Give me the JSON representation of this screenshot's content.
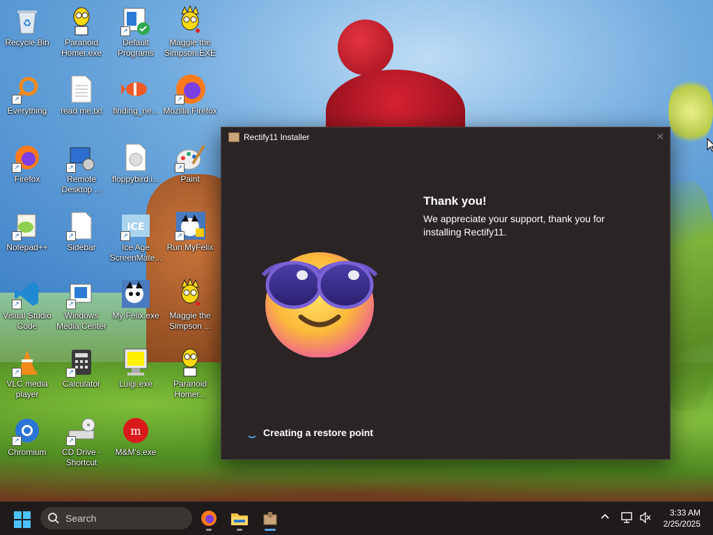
{
  "desktop": {
    "icons": [
      {
        "label": "Recycle Bin",
        "icon": "recycle-bin-icon"
      },
      {
        "label": "Paranoid Homer.exe",
        "icon": "homer-icon"
      },
      {
        "label": "Default Programs",
        "icon": "default-programs-icon"
      },
      {
        "label": "Maggie the Simpson.EXE",
        "icon": "maggie-icon"
      },
      {
        "label": "Everything",
        "icon": "magnifier-icon"
      },
      {
        "label": "read me.txt",
        "icon": "text-file-icon"
      },
      {
        "label": "finding_ne...",
        "icon": "fish-icon"
      },
      {
        "label": "Mozilla Firefox",
        "icon": "firefox-icon"
      },
      {
        "label": "Firefox",
        "icon": "firefox-icon"
      },
      {
        "label": "Remote Desktop ...",
        "icon": "remote-desktop-icon"
      },
      {
        "label": "floppybird.i...",
        "icon": "disc-image-icon"
      },
      {
        "label": "Paint",
        "icon": "paint-icon"
      },
      {
        "label": "Notepad++",
        "icon": "notepadpp-icon"
      },
      {
        "label": "Sidebar",
        "icon": "blank-file-icon"
      },
      {
        "label": "Ice Age ScreenMate...",
        "icon": "ice-age-icon"
      },
      {
        "label": "Run MyFelix",
        "icon": "felix-icon"
      },
      {
        "label": "Visual Studio Code",
        "icon": "vscode-icon"
      },
      {
        "label": "Windows Media Center",
        "icon": "media-center-icon"
      },
      {
        "label": "My Felix.exe",
        "icon": "felix-icon"
      },
      {
        "label": "Maggie the Simpson ...",
        "icon": "maggie-icon"
      },
      {
        "label": "VLC media player",
        "icon": "vlc-icon"
      },
      {
        "label": "Calculator",
        "icon": "calculator-icon"
      },
      {
        "label": "Luigi.exe",
        "icon": "luigi-icon"
      },
      {
        "label": "Paranoid Homer...",
        "icon": "homer-icon"
      },
      {
        "label": "Chromium",
        "icon": "chromium-icon"
      },
      {
        "label": "CD Drive - Shortcut",
        "icon": "cd-drive-icon"
      },
      {
        "label": "M&M's.exe",
        "icon": "mms-icon"
      }
    ]
  },
  "installer": {
    "title": "Rectify11 Installer",
    "heading": "Thank you!",
    "message": "We appreciate your support, thank you for installing Rectify11.",
    "status": "Creating a restore point",
    "close_glyph": "✕"
  },
  "taskbar": {
    "search_placeholder": "Search",
    "apps": [
      {
        "name": "firefox",
        "icon": "firefox-icon"
      },
      {
        "name": "file-explorer",
        "icon": "folder-icon"
      },
      {
        "name": "rectify11-installer",
        "icon": "installer-icon",
        "active": true
      }
    ],
    "time": "3:33 AM",
    "date": "2/25/2025"
  },
  "colors": {
    "accent": "#59a8e8",
    "taskbar": "#201b1b",
    "window_bg": "#2b2424"
  }
}
